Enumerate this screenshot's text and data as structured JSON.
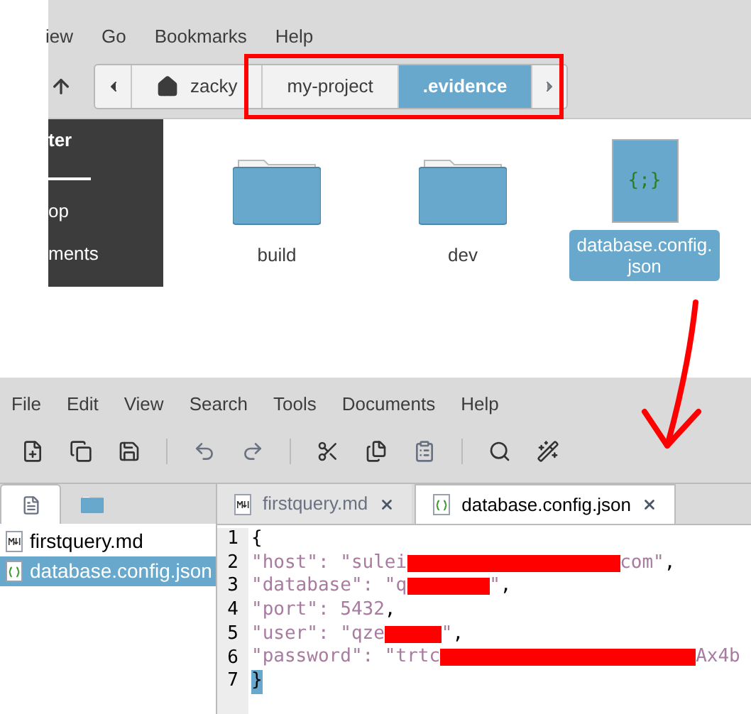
{
  "file_manager": {
    "menu": [
      "iew",
      "Go",
      "Bookmarks",
      "Help"
    ],
    "path": [
      {
        "label": "zacky",
        "kind": "home",
        "selected": false
      },
      {
        "label": "my-project",
        "kind": "folder",
        "selected": false
      },
      {
        "label": ".evidence",
        "kind": "folder",
        "selected": true
      }
    ],
    "sidebar": {
      "heading": "ter",
      "items": [
        "op",
        "ments"
      ]
    },
    "files": [
      {
        "name": "build",
        "kind": "folder",
        "selected": false
      },
      {
        "name": "dev",
        "kind": "folder",
        "selected": false
      },
      {
        "name": "database.config.json",
        "kind": "json",
        "selected": true,
        "glyph": "{;}"
      }
    ]
  },
  "editor": {
    "menu": [
      "File",
      "Edit",
      "View",
      "Search",
      "Tools",
      "Documents",
      "Help"
    ],
    "side_tabs": [
      {
        "kind": "documents",
        "selected": true
      },
      {
        "kind": "folder",
        "selected": false
      }
    ],
    "documents": [
      {
        "name": "firstquery.md",
        "kind": "md",
        "selected": false
      },
      {
        "name": "database.config.json",
        "kind": "json",
        "selected": true
      }
    ],
    "tabs": [
      {
        "name": "firstquery.md",
        "kind": "md",
        "selected": false
      },
      {
        "name": "database.config.json",
        "kind": "json",
        "selected": true
      }
    ],
    "lines": [
      {
        "number": "1",
        "parts": [
          {
            "kind": "text",
            "text": "{"
          }
        ]
      },
      {
        "number": "2",
        "parts": [
          {
            "kind": "key",
            "text": "\"host\": \"sulei"
          },
          {
            "kind": "redaction"
          },
          {
            "kind": "key",
            "text": "com\""
          },
          {
            "kind": "text",
            "text": ","
          }
        ]
      },
      {
        "number": "3",
        "parts": [
          {
            "kind": "key",
            "text": "\"database\": \"q"
          },
          {
            "kind": "redaction"
          },
          {
            "kind": "key",
            "text": "\""
          },
          {
            "kind": "text",
            "text": ","
          }
        ]
      },
      {
        "number": "4",
        "parts": [
          {
            "kind": "key",
            "text": "\"port\": 5432"
          },
          {
            "kind": "text",
            "text": ","
          }
        ]
      },
      {
        "number": "5",
        "parts": [
          {
            "kind": "key",
            "text": "\"user\": \"qze"
          },
          {
            "kind": "redaction"
          },
          {
            "kind": "key",
            "text": "\""
          },
          {
            "kind": "text",
            "text": ","
          }
        ]
      },
      {
        "number": "6",
        "parts": [
          {
            "kind": "key",
            "text": "\"password\": \"trtc"
          },
          {
            "kind": "redaction"
          },
          {
            "kind": "key",
            "text": "Ax4b"
          }
        ]
      },
      {
        "number": "7",
        "parts": [
          {
            "kind": "cursor",
            "text": "}"
          }
        ]
      }
    ]
  }
}
